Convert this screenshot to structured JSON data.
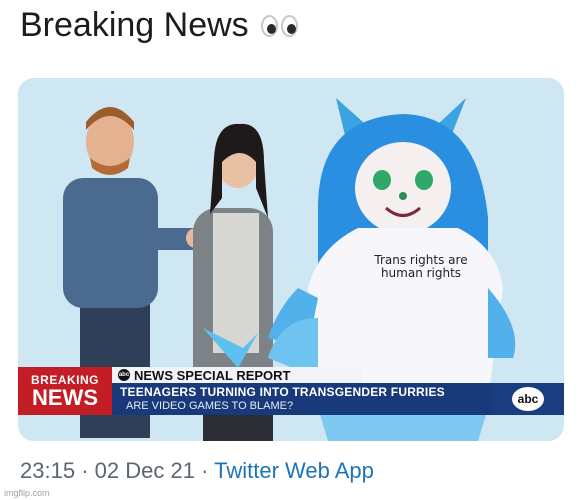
{
  "post": {
    "title": "Breaking News",
    "title_emoji": "eyes-emoji",
    "timestamp": "23:15",
    "separator": "·",
    "date": "02 Dec 21",
    "source": "Twitter Web App"
  },
  "image": {
    "breaking_top": "BREAKING",
    "breaking_bottom": "NEWS",
    "network_special": "NEWS SPECIAL REPORT",
    "network_mini_logo": "abc",
    "headline": "TEENAGERS TURNING INTO TRANSGENDER FURRIES",
    "subheadline": "ARE VIDEO GAMES TO BLAME?",
    "network_logo": "abc",
    "shirt_text": "Trans rights are human rights"
  },
  "watermark": "imgflip.com",
  "colors": {
    "breaking_red": "#c31e25",
    "headline_blue": "#183a7a",
    "link_blue": "#1d74b8"
  }
}
